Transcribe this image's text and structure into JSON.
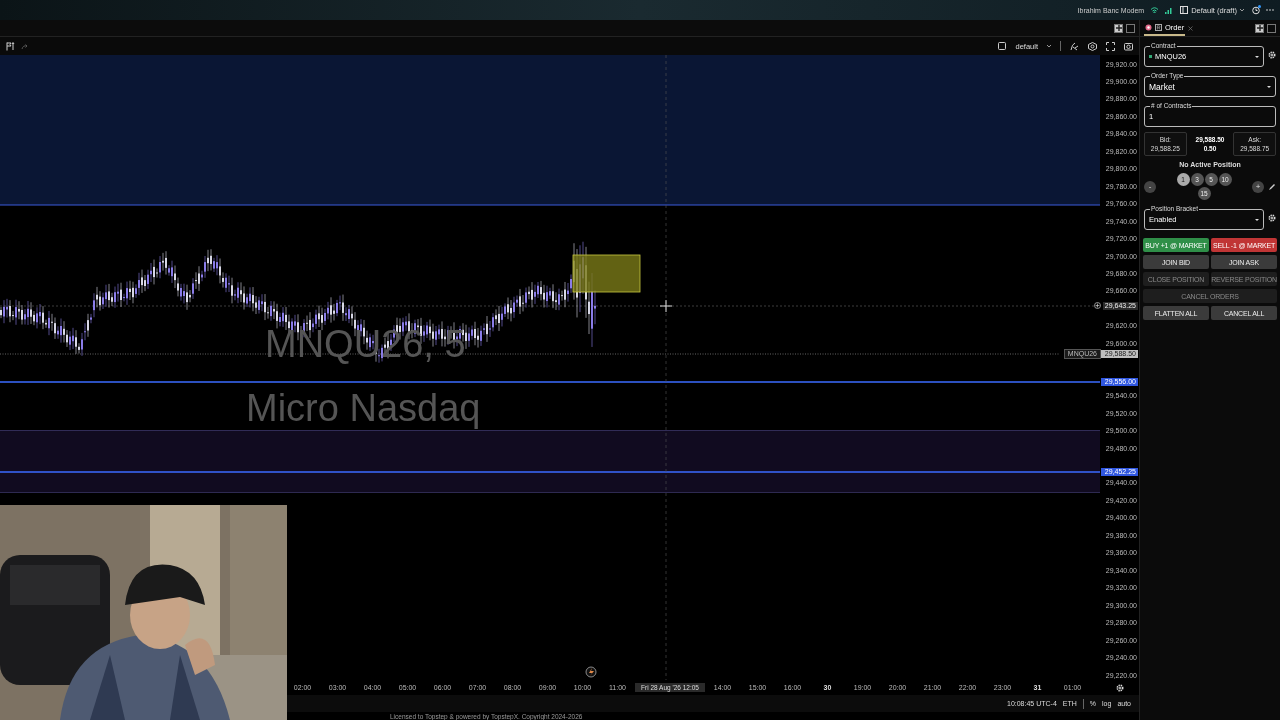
{
  "top_bar": {
    "network_name": "Ibrahim Banc Modem",
    "layout": "Default (draft)"
  },
  "chart_panel": {
    "toolbar": {
      "checked": false,
      "template": "default"
    },
    "watermark": {
      "symbol": "MNQU26, 5",
      "description": "Micro Nasdaq"
    },
    "price_axis": {
      "labels": [
        "29,920.00",
        "29,900.00",
        "29,880.00",
        "29,860.00",
        "29,840.00",
        "29,820.00",
        "29,800.00",
        "29,780.00",
        "29,760.00",
        "29,740.00",
        "29,720.00",
        "29,700.00",
        "29,680.00",
        "29,660.00",
        "29,620.00",
        "29,600.00",
        "29,540.00",
        "29,520.00",
        "29,500.00",
        "29,480.00",
        "29,440.00",
        "29,420.00",
        "29,400.00",
        "29,380.00",
        "29,360.00",
        "29,340.00",
        "29,320.00",
        "29,300.00",
        "29,280.00",
        "29,260.00",
        "29,240.00",
        "29,220.00"
      ],
      "markers": [
        {
          "kind": "crosshair",
          "text": "29,643.25"
        },
        {
          "kind": "last",
          "symbol": "MNQU26",
          "text": "29,588.50"
        },
        {
          "kind": "level",
          "text": "29,556.00"
        },
        {
          "kind": "level",
          "text": "29,452.25"
        }
      ]
    },
    "time_axis": {
      "labels": [
        {
          "kind": "tick",
          "text": "02:00"
        },
        {
          "kind": "tick",
          "text": "03:00"
        },
        {
          "kind": "tick",
          "text": "04:00"
        },
        {
          "kind": "tick",
          "text": "05:00"
        },
        {
          "kind": "tick",
          "text": "06:00"
        },
        {
          "kind": "tick",
          "text": "07:00"
        },
        {
          "kind": "tick",
          "text": "08:00"
        },
        {
          "kind": "tick",
          "text": "09:00"
        },
        {
          "kind": "tick",
          "text": "10:00"
        },
        {
          "kind": "tick",
          "text": "11:00"
        },
        {
          "kind": "crosshair",
          "text": "Fri 28 Aug '26  12:05"
        },
        {
          "kind": "tick",
          "text": "14:00"
        },
        {
          "kind": "tick",
          "text": "15:00"
        },
        {
          "kind": "tick",
          "text": "16:00"
        },
        {
          "kind": "day",
          "text": "30"
        },
        {
          "kind": "tick",
          "text": "19:00"
        },
        {
          "kind": "tick",
          "text": "20:00"
        },
        {
          "kind": "tick",
          "text": "21:00"
        },
        {
          "kind": "tick",
          "text": "22:00"
        },
        {
          "kind": "tick",
          "text": "23:00"
        },
        {
          "kind": "day",
          "text": "31"
        },
        {
          "kind": "tick",
          "text": "01:00"
        }
      ]
    },
    "status": {
      "clock": "10:08:45 UTC-4",
      "session": "ETH",
      "options": [
        "%",
        "log",
        "auto"
      ]
    },
    "footer": "Licensed to Topstep & powered by TopstepX. Copyright 2024-2026"
  },
  "order_panel": {
    "tab": {
      "label": "Order",
      "selected": true
    },
    "contract": {
      "label": "Contract",
      "value": "MNQU26"
    },
    "order_type": {
      "label": "Order Type",
      "value": "Market"
    },
    "contracts": {
      "label": "# of Contracts",
      "value": "1"
    },
    "quote": {
      "bid_label": "Bid:",
      "bid": "29,588.25",
      "last": "29,588.50",
      "change": "0.50",
      "ask_label": "Ask:",
      "ask": "29,588.75"
    },
    "position": "No Active Position",
    "quantity": {
      "minus": "-",
      "plus": "+",
      "chips": [
        {
          "label": "1",
          "selected": true
        },
        {
          "label": "3",
          "selected": false
        },
        {
          "label": "5",
          "selected": false
        },
        {
          "label": "10",
          "selected": false
        },
        {
          "label": "15",
          "selected": false
        }
      ]
    },
    "bracket": {
      "label": "Position Bracket",
      "value": "Enabled"
    },
    "buttons": [
      {
        "label": "BUY +1 @ MARKET",
        "kind": "buy",
        "disabled": false
      },
      {
        "label": "SELL -1 @ MARKET",
        "kind": "sell",
        "disabled": false
      },
      {
        "label": "JOIN BID",
        "kind": "plain",
        "disabled": false
      },
      {
        "label": "JOIN ASK",
        "kind": "plain",
        "disabled": false
      },
      {
        "label": "CLOSE POSITION",
        "kind": "plain",
        "disabled": true
      },
      {
        "label": "REVERSE POSITION",
        "kind": "plain",
        "disabled": true
      },
      {
        "label": "CANCEL ORDERS",
        "kind": "wide",
        "disabled": true
      },
      {
        "label": "FLATTEN ALL",
        "kind": "plain",
        "disabled": false
      },
      {
        "label": "CANCEL ALL",
        "kind": "plain",
        "disabled": false
      }
    ]
  }
}
